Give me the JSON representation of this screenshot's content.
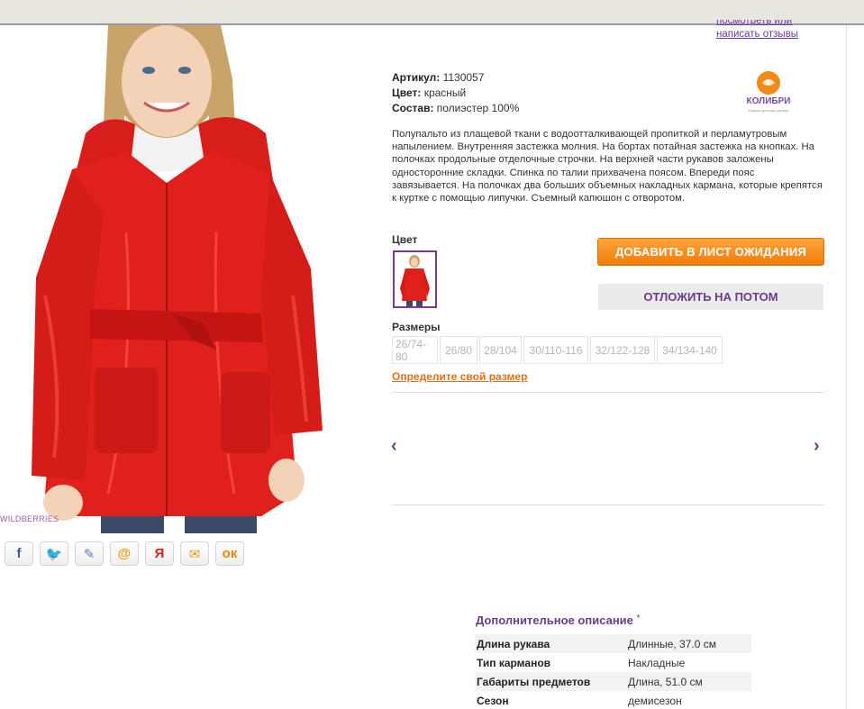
{
  "reviews": {
    "line1": "посмотреть или",
    "line2": "написать отзывы"
  },
  "watermark": "WILDBERRIES",
  "specs": [
    {
      "label": "Артикул:",
      "value": " 1130057"
    },
    {
      "label": "Цвет:",
      "value": " красный"
    },
    {
      "label": "Состав:",
      "value": " полиэстер 100%"
    }
  ],
  "brand": {
    "logo_name": "КОЛИБРИ",
    "tagline": "модная детская одежда"
  },
  "description": "Полупальто из плащевой ткани с водоотталкивающей пропиткой и перламутровым напылением. Внутренняя застежка молния. На бортах потайная застежка на кнопках. На полочках продольные отделочные строчки. На верхней части рукавов заложены односторонние складки. Спинка по талии прихвачена поясом. Впереди пояс завязывается. На полочках два больших объемных накладных кармана, которые крепятся к куртке с помощью липучки. Съемный капюшон с отворотом.",
  "color_label": "Цвет",
  "buttons": {
    "wait_list": "ДОБАВИТЬ В ЛИСТ ОЖИДАНИЯ",
    "later": "ОТЛОЖИТЬ НА ПОТОМ"
  },
  "sizes_label": "Размеры",
  "sizes": [
    "26/74-80",
    "26/80",
    "28/104",
    "30/110-116",
    "32/122-128",
    "34/134-140"
  ],
  "size_link": "Определите свой размер",
  "carousel": {
    "prev": "‹",
    "next": "›"
  },
  "share_icons": [
    {
      "name": "facebook-icon",
      "glyph": "f",
      "color": "#3b5998"
    },
    {
      "name": "twitter-icon",
      "glyph": "🐦",
      "color": "#1da1f2"
    },
    {
      "name": "livejournal-icon",
      "glyph": "✎",
      "color": "#5a7fb5"
    },
    {
      "name": "mailru-icon",
      "glyph": "@",
      "color": "#f59b00"
    },
    {
      "name": "yandex-icon",
      "glyph": "Я",
      "color": "#d8231f"
    },
    {
      "name": "email-icon",
      "glyph": "✉",
      "color": "#e0a020"
    },
    {
      "name": "odnoklassniki-icon",
      "glyph": "ок",
      "color": "#ee8208"
    }
  ],
  "additional": {
    "title": "Дополнительное описание",
    "star": "*",
    "rows": [
      {
        "key": "Длина рукава",
        "value": "Длинные, 37.0 см"
      },
      {
        "key": "Тип карманов",
        "value": "Накладные"
      },
      {
        "key": "Габариты предметов",
        "value": "Длина, 51.0 см"
      },
      {
        "key": "Сезон",
        "value": "демисезон"
      }
    ]
  },
  "colors": {
    "accent_purple": "#6a3a8c",
    "orange": "#f07c0c",
    "coat_red": "#e0201c"
  }
}
